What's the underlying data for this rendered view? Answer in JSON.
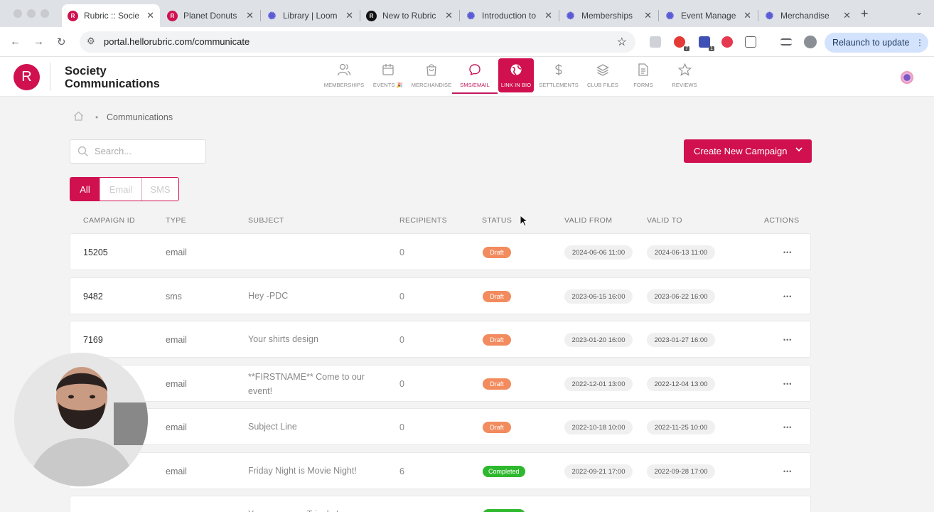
{
  "browser": {
    "tabs": [
      {
        "title": "Rubric :: Socie",
        "favicon": "R",
        "favicon_style": "r",
        "active": true
      },
      {
        "title": "Planet Donuts",
        "favicon": "R",
        "favicon_style": "r",
        "active": false
      },
      {
        "title": "Library | Loom",
        "favicon": "✺",
        "favicon_style": "p",
        "active": false
      },
      {
        "title": "New to Rubric",
        "favicon": "R",
        "favicon_style": "k",
        "active": false
      },
      {
        "title": "Introduction to",
        "favicon": "✺",
        "favicon_style": "p",
        "active": false
      },
      {
        "title": "Memberships",
        "favicon": "✺",
        "favicon_style": "p",
        "active": false
      },
      {
        "title": "Event Manage",
        "favicon": "✺",
        "favicon_style": "p",
        "active": false
      },
      {
        "title": "Merchandise",
        "favicon": "✺",
        "favicon_style": "p",
        "active": false
      }
    ],
    "url": "portal.hellorubric.com/communicate",
    "relaunch_label": "Relaunch to update",
    "extension_badges": [
      "7",
      "1"
    ]
  },
  "app": {
    "logo_letter": "R",
    "org_name": "Society Communications",
    "nav": [
      {
        "label": "MEMBERSHIPS",
        "icon": "people-icon"
      },
      {
        "label": "EVENTS 🎉",
        "icon": "calendar-icon"
      },
      {
        "label": "MERCHANDISE",
        "icon": "bag-icon"
      },
      {
        "label": "SMS/EMAIL",
        "icon": "chat-icon",
        "active": true
      },
      {
        "label": "LINK IN BIO",
        "icon": "globe-icon",
        "featured": true
      },
      {
        "label": "SETTLEMENTS",
        "icon": "dollar-icon"
      },
      {
        "label": "CLUB FILES",
        "icon": "layers-icon"
      },
      {
        "label": "FORMS",
        "icon": "document-icon"
      },
      {
        "label": "REVIEWS",
        "icon": "star-icon"
      }
    ]
  },
  "page": {
    "breadcrumb": "Communications",
    "search_placeholder": "Search...",
    "create_button": "Create New Campaign",
    "filters": [
      "All",
      "Email",
      "SMS"
    ],
    "active_filter": "All"
  },
  "table": {
    "columns": [
      "CAMPAIGN ID",
      "TYPE",
      "SUBJECT",
      "RECIPIENTS",
      "STATUS",
      "VALID FROM",
      "VALID TO",
      "ACTIONS"
    ],
    "rows": [
      {
        "id": "15205",
        "type": "email",
        "subject": "",
        "recipients": "0",
        "status": "Draft",
        "valid_from": "2024-06-06 11:00",
        "valid_to": "2024-06-13 11:00"
      },
      {
        "id": "9482",
        "type": "sms",
        "subject": "Hey -PDC",
        "recipients": "0",
        "status": "Draft",
        "valid_from": "2023-06-15 16:00",
        "valid_to": "2023-06-22 16:00"
      },
      {
        "id": "7169",
        "type": "email",
        "subject": "Your shirts design",
        "recipients": "0",
        "status": "Draft",
        "valid_from": "2023-01-20 16:00",
        "valid_to": "2023-01-27 16:00"
      },
      {
        "id": "",
        "type": "email",
        "subject": "**FIRSTNAME** Come to our event!",
        "recipients": "0",
        "status": "Draft",
        "valid_from": "2022-12-01 13:00",
        "valid_to": "2022-12-04 13:00"
      },
      {
        "id": "",
        "type": "email",
        "subject": "Subject Line",
        "recipients": "0",
        "status": "Draft",
        "valid_from": "2022-10-18 10:00",
        "valid_to": "2022-11-25 10:00"
      },
      {
        "id": "",
        "type": "email",
        "subject": "Friday Night is Movie Night!",
        "recipients": "6",
        "status": "Completed",
        "valid_from": "2022-09-21 17:00",
        "valid_to": "2022-09-28 17:00"
      },
      {
        "id": "",
        "type": "",
        "subject": "You are now a Tripple Layer",
        "recipients": "",
        "status": "Completed",
        "valid_from": "",
        "valid_to": ""
      }
    ]
  },
  "colors": {
    "brand": "#d0104f",
    "draft": "#f28b5e",
    "completed": "#2eb82e"
  }
}
